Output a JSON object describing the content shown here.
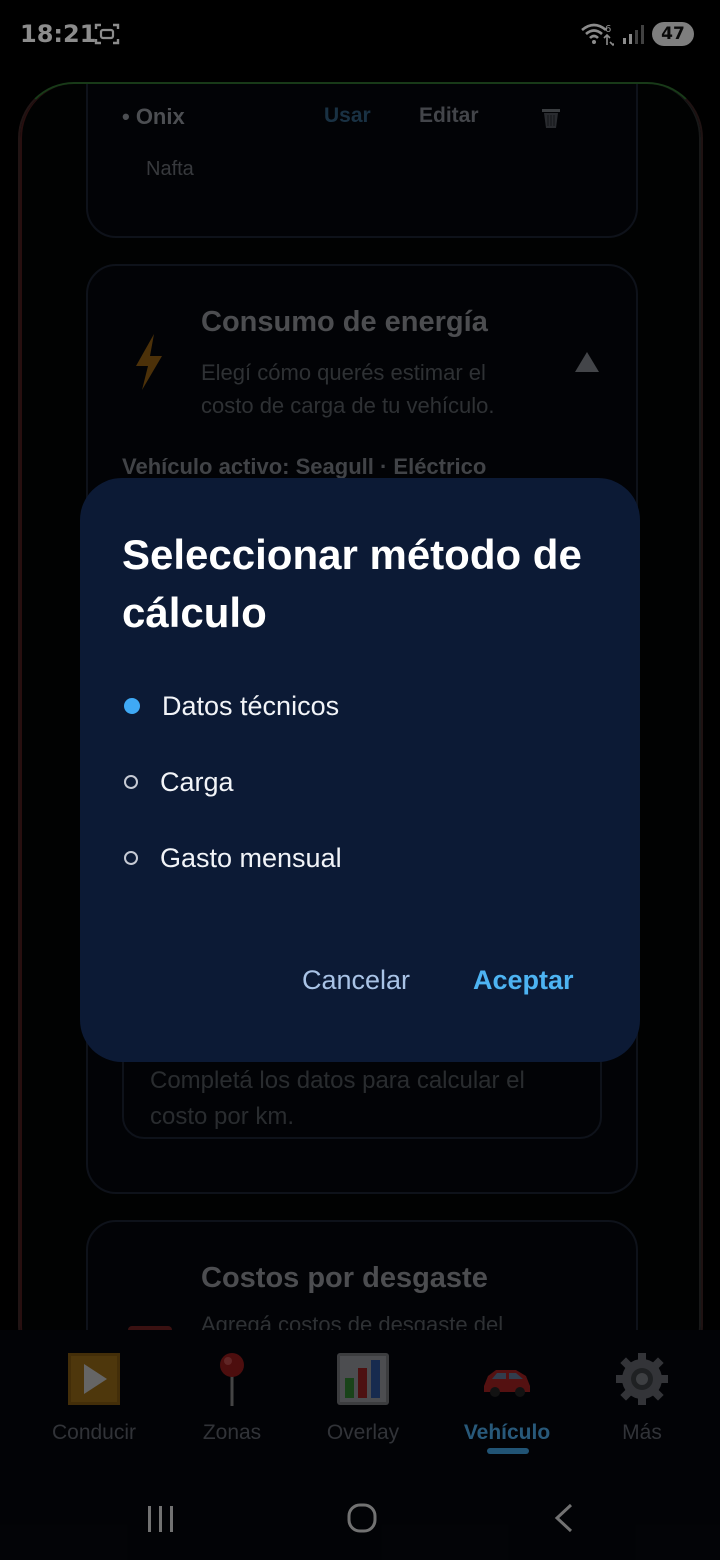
{
  "status_bar": {
    "time": "18:21",
    "battery": "47",
    "wifi_badge": "6"
  },
  "vehicle_card": {
    "name": "• Onix",
    "use_label": "Usar",
    "edit_label": "Editar",
    "fuel": "Nafta"
  },
  "energy_card": {
    "title": "Consumo de energía",
    "description": "Elegí cómo querés estimar el costo de carga de tu vehículo.",
    "active_vehicle": "Vehículo activo: Seagull · Eléctrico",
    "hint": "Completá los datos para calcular el costo por km."
  },
  "wear_card": {
    "title": "Costos por desgaste",
    "description": "Agregá costos de desgaste del"
  },
  "dialog": {
    "title": "Seleccionar método de cálculo",
    "options": [
      {
        "label": "Datos técnicos",
        "selected": true
      },
      {
        "label": "Carga",
        "selected": false
      },
      {
        "label": "Gasto mensual",
        "selected": false
      }
    ],
    "cancel_label": "Cancelar",
    "accept_label": "Aceptar"
  },
  "bottom_nav": {
    "items": [
      {
        "label": "Conducir",
        "icon": "play-icon"
      },
      {
        "label": "Zonas",
        "icon": "pin-icon"
      },
      {
        "label": "Overlay",
        "icon": "bar-chart-icon"
      },
      {
        "label": "Vehículo",
        "icon": "car-icon",
        "active": true
      },
      {
        "label": "Más",
        "icon": "gear-icon"
      }
    ]
  },
  "colors": {
    "accent": "#4aa3df",
    "dialog_bg": "#0c1a35",
    "selected_radio": "#3fa9f5"
  }
}
